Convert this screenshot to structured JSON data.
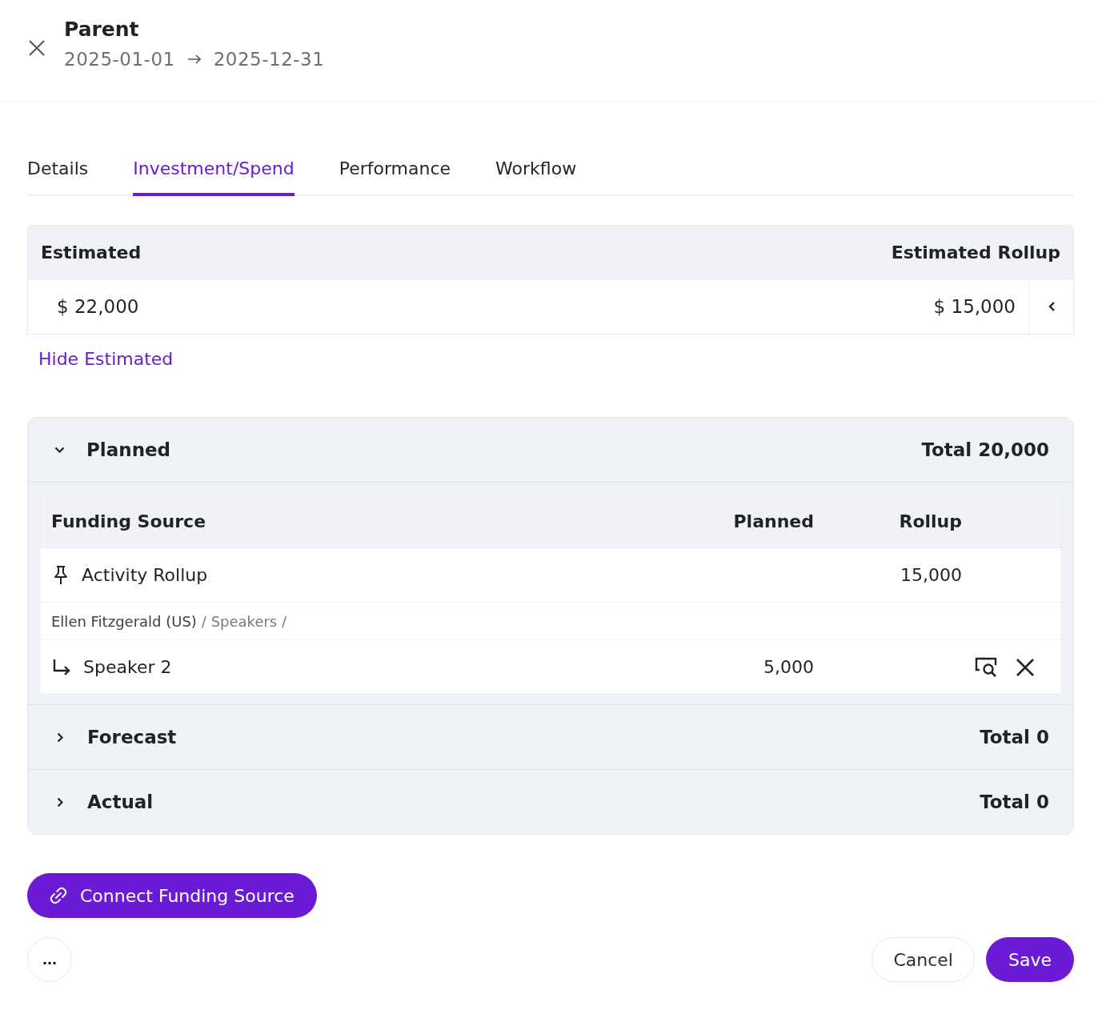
{
  "header": {
    "title": "Parent",
    "start_date": "2025-01-01",
    "end_date": "2025-12-31"
  },
  "tabs": [
    {
      "label": "Details",
      "selected": false
    },
    {
      "label": "Investment/Spend",
      "selected": true
    },
    {
      "label": "Performance",
      "selected": false
    },
    {
      "label": "Workflow",
      "selected": false
    }
  ],
  "estimated": {
    "columns": [
      "Estimated",
      "Estimated Rollup"
    ],
    "value": "$ 22,000",
    "rollup": "$ 15,000",
    "toggle_link": "Hide Estimated"
  },
  "sections": [
    {
      "title": "Planned",
      "total": "Total 20,000",
      "expanded": true,
      "table": {
        "columns": [
          "Funding Source",
          "Planned",
          "Rollup"
        ],
        "rows": [
          {
            "kind": "source",
            "name": "Activity Rollup",
            "planned": "",
            "rollup": "15,000"
          },
          {
            "kind": "path",
            "owner": "Ellen Fitzgerald (US)",
            "trail": "/ Speakers /"
          },
          {
            "kind": "child",
            "name": "Speaker 2",
            "planned": "5,000",
            "rollup": ""
          }
        ]
      }
    },
    {
      "title": "Forecast",
      "total": "Total 0",
      "expanded": false
    },
    {
      "title": "Actual",
      "total": "Total 0",
      "expanded": false
    }
  ],
  "connect_button": "Connect Funding Source",
  "footer": {
    "more_button": "...",
    "cancel_button": "Cancel",
    "save_button": "Save"
  }
}
